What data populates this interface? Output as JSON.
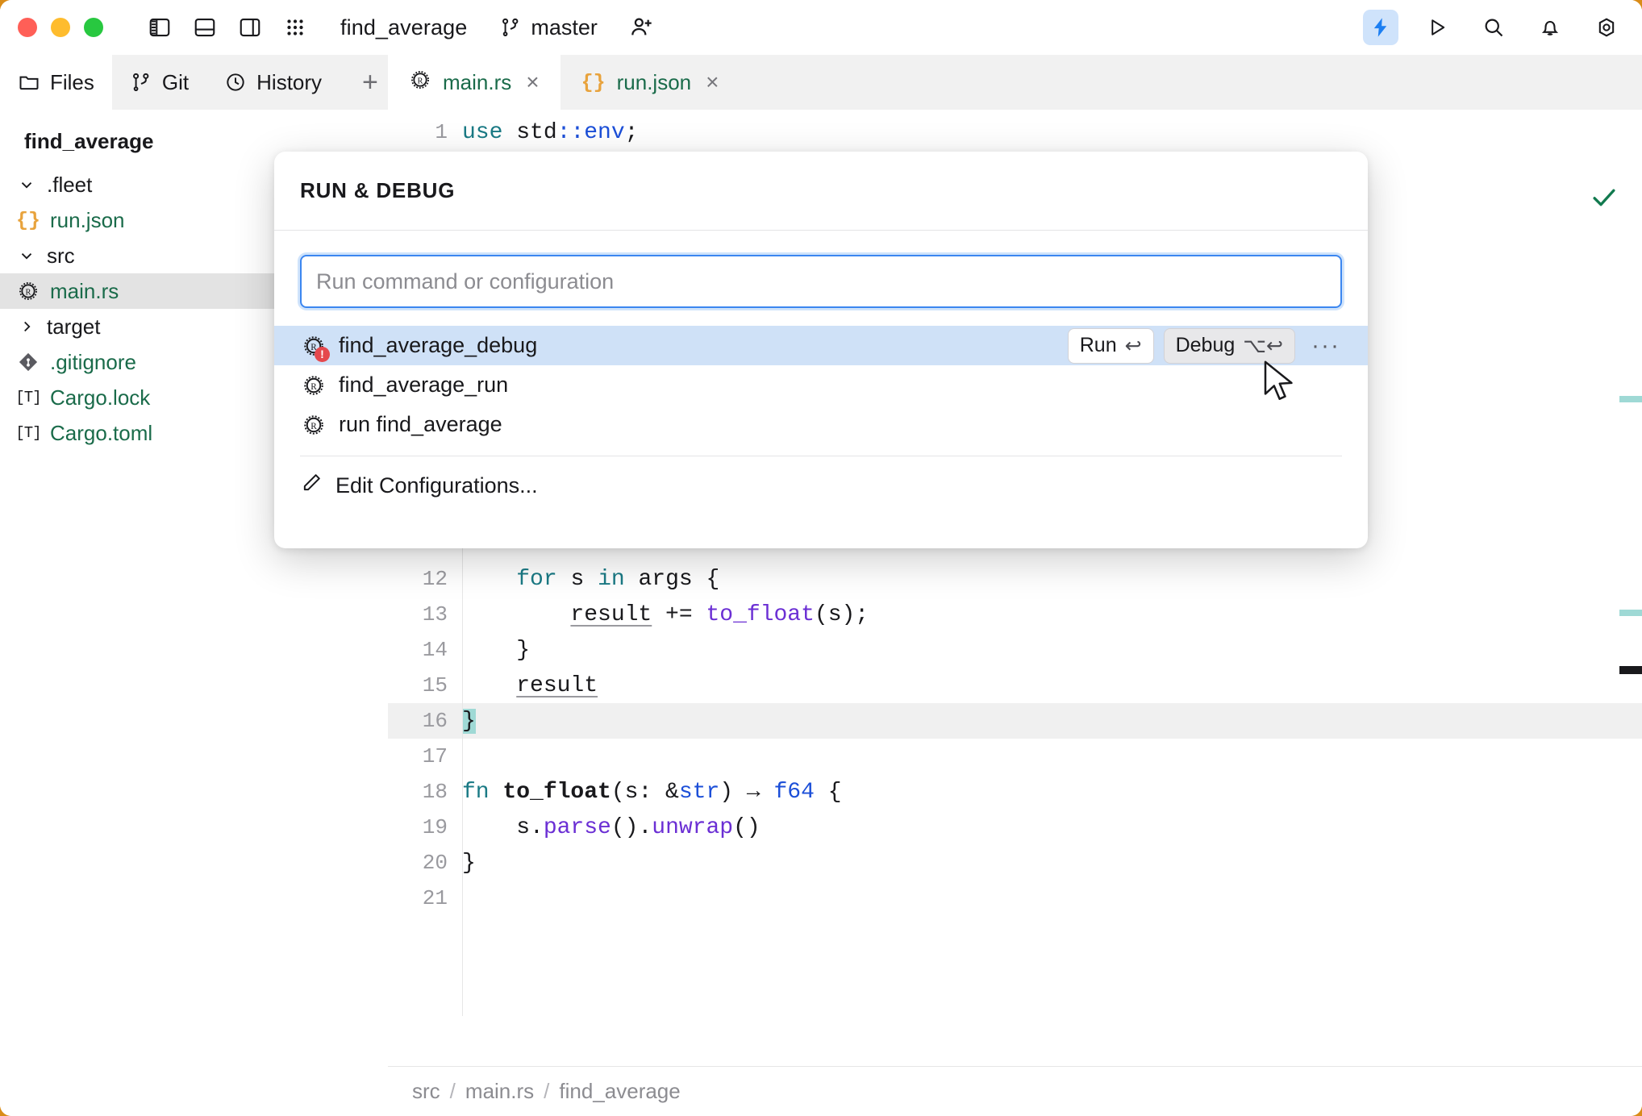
{
  "titlebar": {
    "project": "find_average",
    "branch": "master",
    "icons": {
      "left_panel": "left-panel-icon",
      "bottom_panel": "bottom-panel-icon",
      "right_panel": "right-panel-icon",
      "grid": "grid-icon",
      "branch": "git-branch-icon",
      "add_person": "add-person-icon"
    },
    "right_icons": [
      {
        "name": "run-debug-bolt-icon",
        "active": true
      },
      {
        "name": "run-icon",
        "active": false
      },
      {
        "name": "search-icon",
        "active": false
      },
      {
        "name": "notifications-bell-icon",
        "active": false
      },
      {
        "name": "settings-gear-icon",
        "active": false
      }
    ]
  },
  "sidebar": {
    "tabs": [
      {
        "label": "Files",
        "icon": "folder-icon",
        "active": true
      },
      {
        "label": "Git",
        "icon": "git-branch-icon",
        "active": false
      },
      {
        "label": "History",
        "icon": "clock-icon",
        "active": false
      }
    ],
    "add_tab_label": "+",
    "root": "find_average",
    "tree": [
      {
        "label": ".fleet",
        "type": "folder",
        "expanded": true,
        "indent": 0,
        "selected": false,
        "icon": "chevron-down-icon"
      },
      {
        "label": "run.json",
        "type": "json",
        "indent": 1,
        "selected": false,
        "icon": "json-icon"
      },
      {
        "label": "src",
        "type": "folder",
        "expanded": true,
        "indent": 0,
        "selected": false,
        "icon": "chevron-down-icon"
      },
      {
        "label": "main.rs",
        "type": "rust",
        "indent": 1,
        "selected": true,
        "icon": "rust-icon"
      },
      {
        "label": "target",
        "type": "folder",
        "expanded": false,
        "indent": 0,
        "selected": false,
        "icon": "chevron-right-icon"
      },
      {
        "label": ".gitignore",
        "type": "git",
        "indent": 0,
        "selected": false,
        "icon": "git-file-icon"
      },
      {
        "label": "Cargo.lock",
        "type": "toml",
        "indent": 0,
        "selected": false,
        "icon": "toml-icon"
      },
      {
        "label": "Cargo.toml",
        "type": "toml",
        "indent": 0,
        "selected": false,
        "icon": "toml-icon"
      }
    ]
  },
  "editor": {
    "tabs": [
      {
        "label": "main.rs",
        "icon": "rust-icon",
        "active": true,
        "close": "×"
      },
      {
        "label": "run.json",
        "icon": "json-icon",
        "active": false,
        "close": "×"
      }
    ],
    "breadcrumb": [
      "src",
      "main.rs",
      "find_average"
    ],
    "breadcrumb_sep": "/",
    "status_icon": "check-icon",
    "lines": [
      {
        "n": "1",
        "html": "<span class='kw'>use</span> std<span class='blu'>::env</span>;"
      },
      {
        "n": "12",
        "html": "    <span class='kw'>for</span> s <span class='kw'>in</span> args {"
      },
      {
        "n": "13",
        "html": "        <span class='und'>result</span> += <span class='pur'>to_float</span>(s);"
      },
      {
        "n": "14",
        "html": "    }"
      },
      {
        "n": "15",
        "html": "    <span class='und'>result</span>"
      },
      {
        "n": "16",
        "html": "<span class='caret-blk'>}</span>",
        "highlight": true
      },
      {
        "n": "17",
        "html": ""
      },
      {
        "n": "18",
        "html": "<span class='kw'>fn</span> <span class='bold'>to_float</span>(s: &amp;<span class='blu'>str</span>) → <span class='blu'>f64</span> {"
      },
      {
        "n": "19",
        "html": "    s.<span class='pur'>parse</span>().<span class='pur'>unwrap</span>()"
      },
      {
        "n": "20",
        "html": "}"
      },
      {
        "n": "21",
        "html": ""
      }
    ]
  },
  "dialog": {
    "title": "RUN & DEBUG",
    "input_placeholder": "Run command or configuration",
    "input_value": "",
    "configs": [
      {
        "label": "find_average_debug",
        "icon": "rust-icon",
        "has_error": true,
        "error_badge": "!",
        "selected": true,
        "run_label": "Run",
        "run_shortcut": "↩",
        "debug_label": "Debug",
        "debug_shortcut": "⌥↩",
        "more_label": "···"
      },
      {
        "label": "find_average_run",
        "icon": "rust-icon",
        "has_error": false,
        "selected": false
      },
      {
        "label": "run find_average",
        "icon": "rust-icon",
        "has_error": false,
        "selected": false
      }
    ],
    "edit_label": "Edit Configurations...",
    "edit_icon": "pencil-icon"
  },
  "colors": {
    "accent_blue": "#3b86f0",
    "selection_blue": "#cfe1f7",
    "file_green": "#1a6b4a",
    "error_red": "#e5484d",
    "marker_teal": "#9fd9d5",
    "json_orange": "#e8a33d",
    "window_border": "#d98c18"
  }
}
